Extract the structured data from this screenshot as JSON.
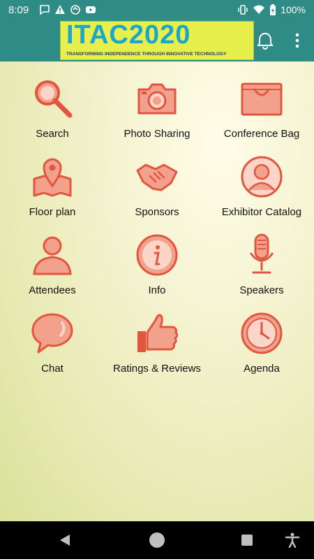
{
  "status": {
    "time": "8:09",
    "battery": "100%"
  },
  "header": {
    "logo_text": "ITAC2020",
    "logo_tagline": "TRANSFORMING INDEPENDENCE THROUGH INNOVATIVE TECHNOLOGY"
  },
  "menu": [
    {
      "label": "Search",
      "icon": "search-icon"
    },
    {
      "label": "Photo Sharing",
      "icon": "camera-icon"
    },
    {
      "label": "Conference Bag",
      "icon": "bag-icon"
    },
    {
      "label": "Floor plan",
      "icon": "map-pin-icon"
    },
    {
      "label": "Sponsors",
      "icon": "handshake-icon"
    },
    {
      "label": "Exhibitor Catalog",
      "icon": "person-circle-icon"
    },
    {
      "label": "Attendees",
      "icon": "person-icon"
    },
    {
      "label": "Info",
      "icon": "info-icon"
    },
    {
      "label": "Speakers",
      "icon": "microphone-icon"
    },
    {
      "label": "Chat",
      "icon": "chat-bubble-icon"
    },
    {
      "label": "Ratings & Reviews",
      "icon": "thumbs-up-icon"
    },
    {
      "label": "Agenda",
      "icon": "clock-icon"
    }
  ],
  "colors": {
    "header": "#2e8b86",
    "icon_fill": "#f2a28c",
    "icon_stroke": "#e2553f",
    "logo_bg": "#e7f04a"
  }
}
